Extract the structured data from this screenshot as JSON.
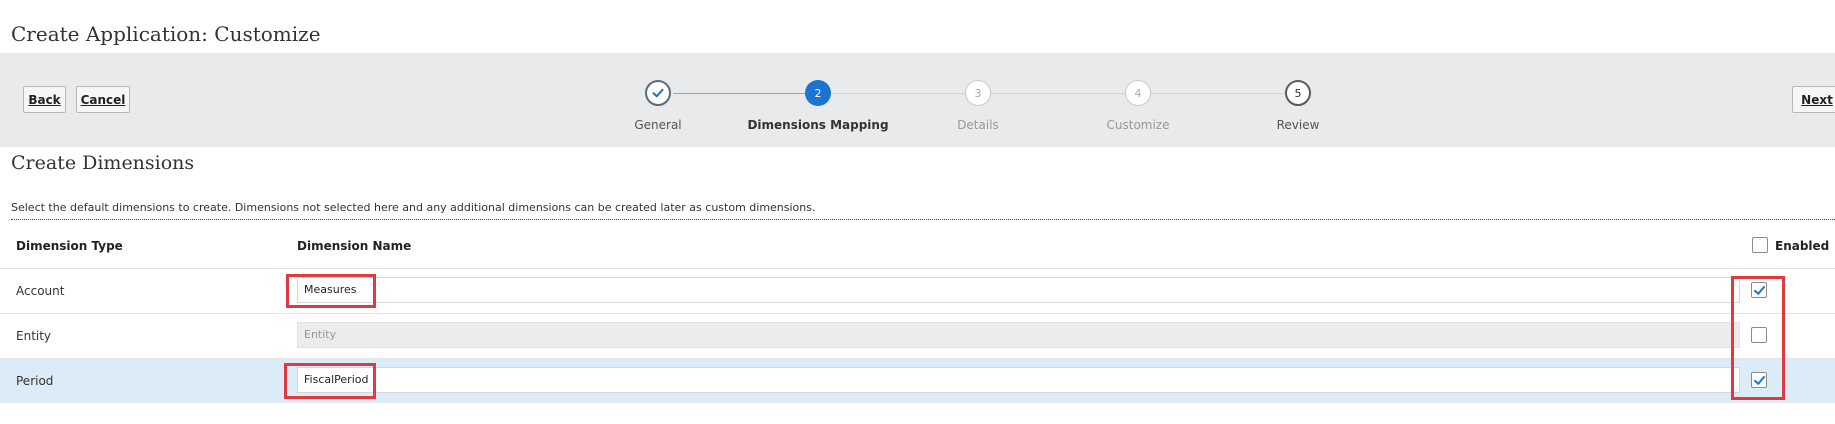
{
  "page": {
    "title": "Create Application: Customize"
  },
  "train": {
    "back_label": "Back",
    "cancel_label": "Cancel",
    "next_label": "Next",
    "steps": [
      {
        "number": "1",
        "label": "General",
        "state": "completed"
      },
      {
        "number": "2",
        "label": "Dimensions Mapping",
        "state": "current"
      },
      {
        "number": "3",
        "label": "Details",
        "state": "disabled"
      },
      {
        "number": "4",
        "label": "Customize",
        "state": "disabled"
      },
      {
        "number": "5",
        "label": "Review",
        "state": "enabled"
      }
    ]
  },
  "section": {
    "title": "Create Dimensions",
    "description": "Select the default dimensions to create. Dimensions not selected here and any additional dimensions can be created later as custom dimensions."
  },
  "table": {
    "headers": {
      "type": "Dimension Type",
      "name": "Dimension Name",
      "enabled": "Enabled"
    },
    "header_enabled_checked": false,
    "rows": [
      {
        "type": "Account",
        "name": "Measures",
        "editable": true,
        "enabled": true,
        "selected": false
      },
      {
        "type": "Entity",
        "name": "Entity",
        "editable": false,
        "enabled": false,
        "selected": false
      },
      {
        "type": "Period",
        "name": "FiscalPeriod",
        "editable": true,
        "enabled": true,
        "selected": true
      }
    ]
  },
  "colors": {
    "accent": "#1a74d0",
    "highlight": "#e0393e",
    "selected_row": "#dbecf8",
    "train_background": "#e8eaec"
  }
}
